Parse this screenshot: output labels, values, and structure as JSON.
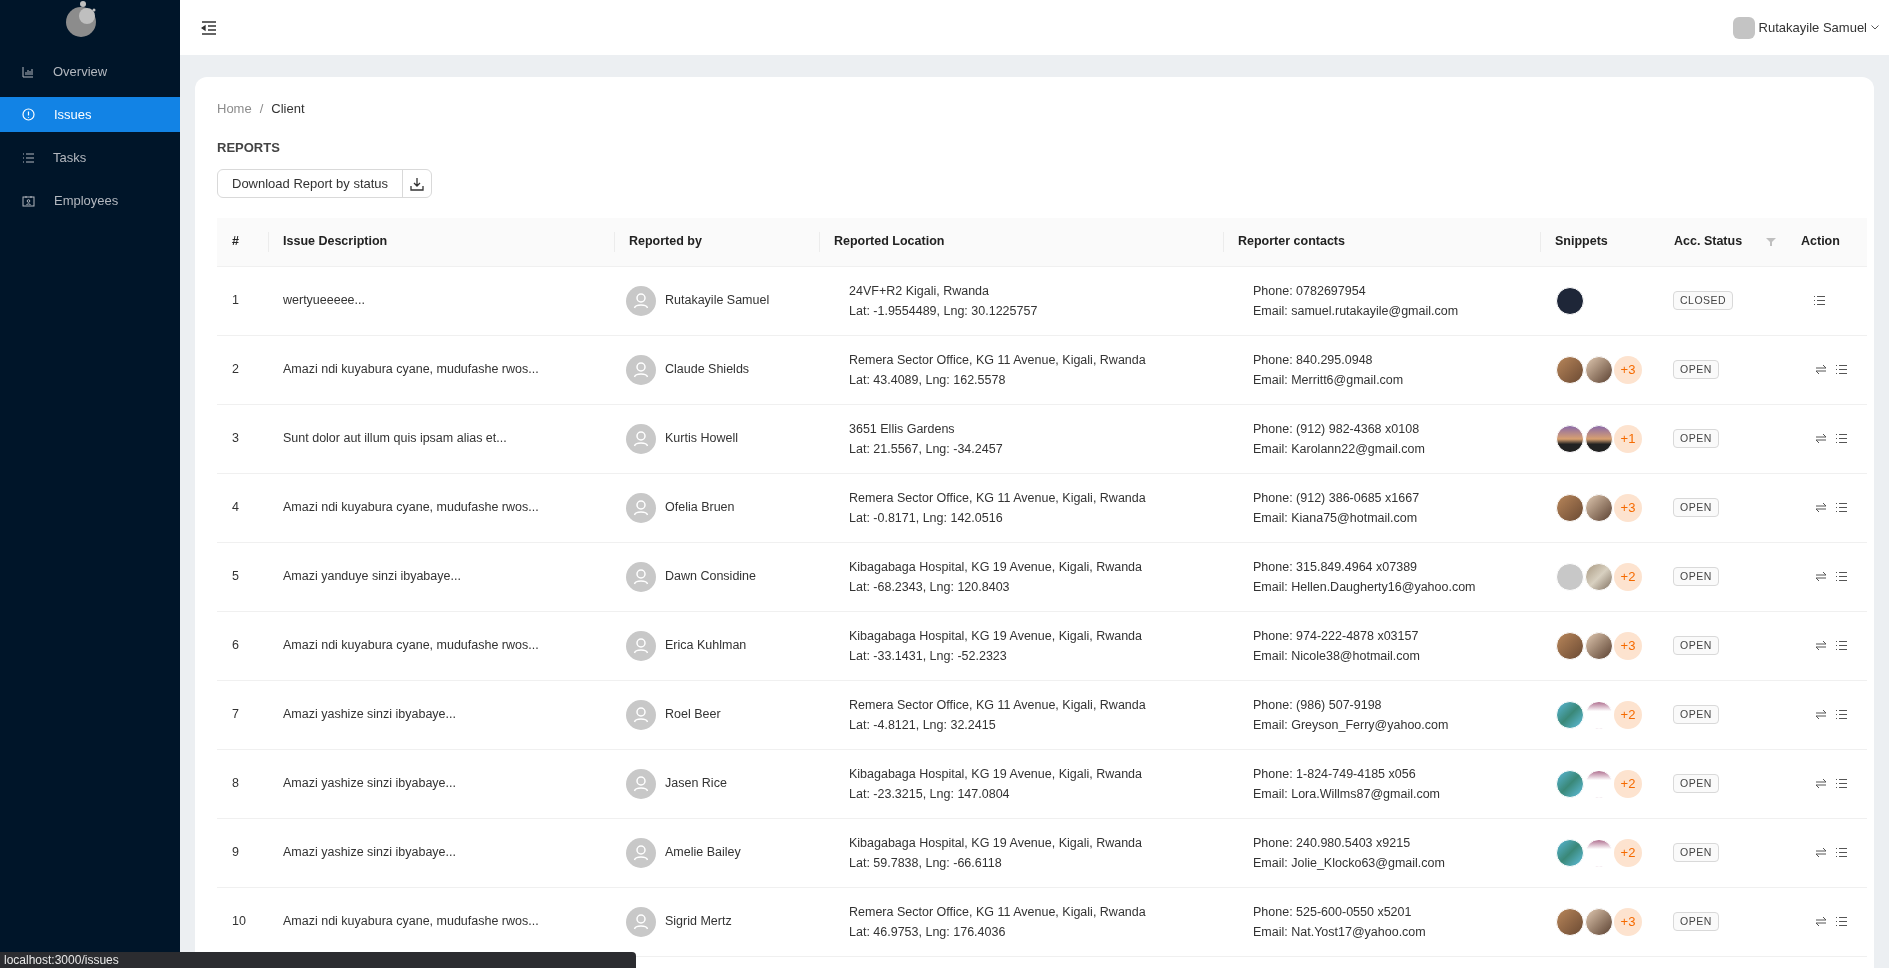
{
  "sidebar": {
    "items": [
      {
        "label": "Overview",
        "selected": false
      },
      {
        "label": "Issues",
        "selected": true
      },
      {
        "label": "Tasks",
        "selected": false
      },
      {
        "label": "Employees",
        "selected": false
      }
    ]
  },
  "header": {
    "user_name": "Rutakayile Samuel"
  },
  "breadcrumb": {
    "items": [
      "Home",
      "Client"
    ],
    "separator": "/"
  },
  "page_title": "REPORTS",
  "download_button": {
    "label": "Download Report by status"
  },
  "table": {
    "columns": [
      "#",
      "Issue Description",
      "Reported by",
      "Reported Location",
      "Reporter contacts",
      "Snippets",
      "Acc. Status",
      "Action"
    ],
    "rows": [
      {
        "index": "1",
        "description": "wertyueeeee...",
        "reporter": "Rutakayile Samuel",
        "location": "24VF+R2 Kigali, Rwanda",
        "coords": "Lat: -1.9554489, Lng: 30.1225757",
        "phone": "Phone: 0782697954",
        "email": "Email: samuel.rutakayile@gmail.com",
        "snippets": {
          "thumbnails": [
            {
              "kind": "dark"
            }
          ]
        },
        "status": "CLOSED",
        "actions": [
          {
            "kind": "list"
          }
        ]
      },
      {
        "index": "2",
        "description": "Amazi ndi kuyabura cyane, mudufashe rwos...",
        "reporter": "Claude Shields",
        "location": "Remera Sector Office, KG 11 Avenue, Kigali, Rwanda",
        "coords": "Lat: 43.4089, Lng: 162.5578",
        "phone": "Phone: 840.295.0948",
        "email": "Email: Merritt6@gmail.com",
        "snippets": {
          "thumbnails": [
            {
              "kind": "warm"
            },
            {
              "kind": "brown"
            }
          ],
          "more": "+3"
        },
        "status": "OPEN",
        "actions": [
          {
            "kind": "swap"
          },
          {
            "kind": "list"
          }
        ]
      },
      {
        "index": "3",
        "description": "Sunt dolor aut illum quis ipsam alias et...",
        "reporter": "Kurtis Howell",
        "location": "3651 Ellis Gardens",
        "coords": "Lat: 21.5567, Lng: -34.2457",
        "phone": "Phone: (912) 982-4368 x0108",
        "email": "Email: Karolann22@gmail.com",
        "snippets": {
          "thumbnails": [
            {
              "kind": "dusk"
            },
            {
              "kind": "dusk"
            }
          ],
          "more": "+1"
        },
        "status": "OPEN",
        "actions": [
          {
            "kind": "swap"
          },
          {
            "kind": "list"
          }
        ]
      },
      {
        "index": "4",
        "description": "Amazi ndi kuyabura cyane, mudufashe rwos...",
        "reporter": "Ofelia Bruen",
        "location": "Remera Sector Office, KG 11 Avenue, Kigali, Rwanda",
        "coords": "Lat: -0.8171, Lng: 142.0516",
        "phone": "Phone: (912) 386-0685 x1667",
        "email": "Email: Kiana75@hotmail.com",
        "snippets": {
          "thumbnails": [
            {
              "kind": "warm"
            },
            {
              "kind": "brown"
            }
          ],
          "more": "+3"
        },
        "status": "OPEN",
        "actions": [
          {
            "kind": "swap"
          },
          {
            "kind": "list"
          }
        ]
      },
      {
        "index": "5",
        "description": "Amazi yanduye sinzi ibyabaye...",
        "reporter": "Dawn Considine",
        "location": "Kibagabaga Hospital, KG 19 Avenue, Kigali, Rwanda",
        "coords": "Lat: -68.2343, Lng: 120.8403",
        "phone": "Phone: 315.849.4964 x07389",
        "email": "Email: Hellen.Daugherty16@yahoo.com",
        "snippets": {
          "thumbnails": [
            {
              "kind": "blank"
            },
            {
              "kind": "stone"
            }
          ],
          "more": "+2"
        },
        "status": "OPEN",
        "actions": [
          {
            "kind": "swap"
          },
          {
            "kind": "list"
          }
        ]
      },
      {
        "index": "6",
        "description": "Amazi ndi kuyabura cyane, mudufashe rwos...",
        "reporter": "Erica Kuhlman",
        "location": "Kibagabaga Hospital, KG 19 Avenue, Kigali, Rwanda",
        "coords": "Lat: -33.1431, Lng: -52.2323",
        "phone": "Phone: 974-222-4878 x03157",
        "email": "Email: Nicole38@hotmail.com",
        "snippets": {
          "thumbnails": [
            {
              "kind": "warm"
            },
            {
              "kind": "brown"
            }
          ],
          "more": "+3"
        },
        "status": "OPEN",
        "actions": [
          {
            "kind": "swap"
          },
          {
            "kind": "list"
          }
        ]
      },
      {
        "index": "7",
        "description": "Amazi yashize sinzi ibyabaye...",
        "reporter": "Roel Beer",
        "location": "Remera Sector Office, KG 11 Avenue, Kigali, Rwanda",
        "coords": "Lat: -4.8121, Lng: 32.2415",
        "phone": "Phone: (986) 507-9198",
        "email": "Email: Greyson_Ferry@yahoo.com",
        "snippets": {
          "thumbnails": [
            {
              "kind": "teal"
            },
            {
              "kind": "strip"
            }
          ],
          "more": "+2"
        },
        "status": "OPEN",
        "actions": [
          {
            "kind": "swap"
          },
          {
            "kind": "list"
          }
        ]
      },
      {
        "index": "8",
        "description": "Amazi yashize sinzi ibyabaye...",
        "reporter": "Jasen Rice",
        "location": "Kibagabaga Hospital, KG 19 Avenue, Kigali, Rwanda",
        "coords": "Lat: -23.3215, Lng: 147.0804",
        "phone": "Phone: 1-824-749-4185 x056",
        "email": "Email: Lora.Willms87@gmail.com",
        "snippets": {
          "thumbnails": [
            {
              "kind": "teal"
            },
            {
              "kind": "strip"
            }
          ],
          "more": "+2"
        },
        "status": "OPEN",
        "actions": [
          {
            "kind": "swap"
          },
          {
            "kind": "list"
          }
        ]
      },
      {
        "index": "9",
        "description": "Amazi yashize sinzi ibyabaye...",
        "reporter": "Amelie Bailey",
        "location": "Kibagabaga Hospital, KG 19 Avenue, Kigali, Rwanda",
        "coords": "Lat: 59.7838, Lng: -66.6118",
        "phone": "Phone: 240.980.5403 x9215",
        "email": "Email: Jolie_Klocko63@gmail.com",
        "snippets": {
          "thumbnails": [
            {
              "kind": "teal"
            },
            {
              "kind": "strip"
            }
          ],
          "more": "+2"
        },
        "status": "OPEN",
        "actions": [
          {
            "kind": "swap"
          },
          {
            "kind": "list"
          }
        ]
      },
      {
        "index": "10",
        "description": "Amazi ndi kuyabura cyane, mudufashe rwos...",
        "reporter": "Sigrid Mertz",
        "location": "Remera Sector Office, KG 11 Avenue, Kigali, Rwanda",
        "coords": "Lat: 46.9753, Lng: 176.4036",
        "phone": "Phone: 525-600-0550 x5201",
        "email": "Email: Nat.Yost17@yahoo.com",
        "snippets": {
          "thumbnails": [
            {
              "kind": "warm"
            },
            {
              "kind": "brown"
            }
          ],
          "more": "+3"
        },
        "status": "OPEN",
        "actions": [
          {
            "kind": "swap"
          },
          {
            "kind": "list"
          }
        ]
      }
    ]
  },
  "browser_status_url": "localhost:3000/issues"
}
